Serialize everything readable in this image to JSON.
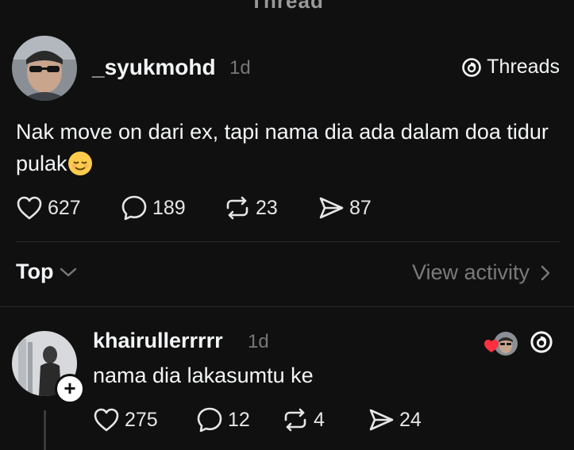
{
  "header": {
    "cut_title": "Thread"
  },
  "post": {
    "author": "_syukmohd",
    "time": "1d",
    "badge_label": "Threads",
    "text": "Nak move on dari ex, tapi nama dia ada dalam doa tidur pulak",
    "emoji": "relieved-face",
    "likes": "627",
    "comments": "189",
    "reposts": "23",
    "shares": "87"
  },
  "sort": {
    "label": "Top",
    "view_activity": "View activity"
  },
  "reply": {
    "author": "khairullerrrrr",
    "time": "1d",
    "text": "nama dia lakasumtu ke",
    "follow_icon": "+",
    "likes": "275",
    "comments": "12",
    "reposts": "4",
    "shares": "24"
  },
  "colors": {
    "background": "#101010",
    "text": "#f3f5f7",
    "muted": "#777777",
    "heart": "#ff3040"
  }
}
